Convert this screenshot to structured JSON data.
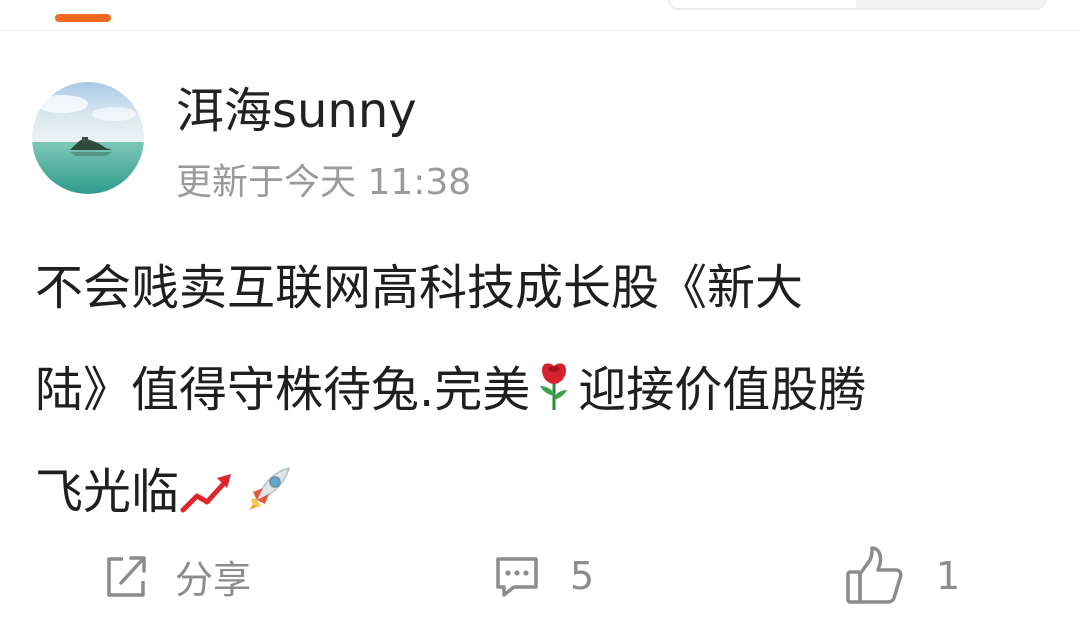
{
  "post": {
    "username": "洱海sunny",
    "timestamp": "更新于今天 11:38",
    "body_lines": [
      "不会贱卖互联网高科技成长股《新大",
      "陆》值得守株待兔.完美",
      "迎接价值股腾",
      "飞光临"
    ],
    "emojis": [
      "rose-icon",
      "chart-increasing-icon",
      "rocket-icon"
    ]
  },
  "actions": {
    "share_label": "分享",
    "comment_count": "5",
    "like_count": "1"
  },
  "colors": {
    "accent": "#f06a24",
    "muted_text": "#9a9a9a",
    "icon_gray": "#8c8c8c"
  }
}
